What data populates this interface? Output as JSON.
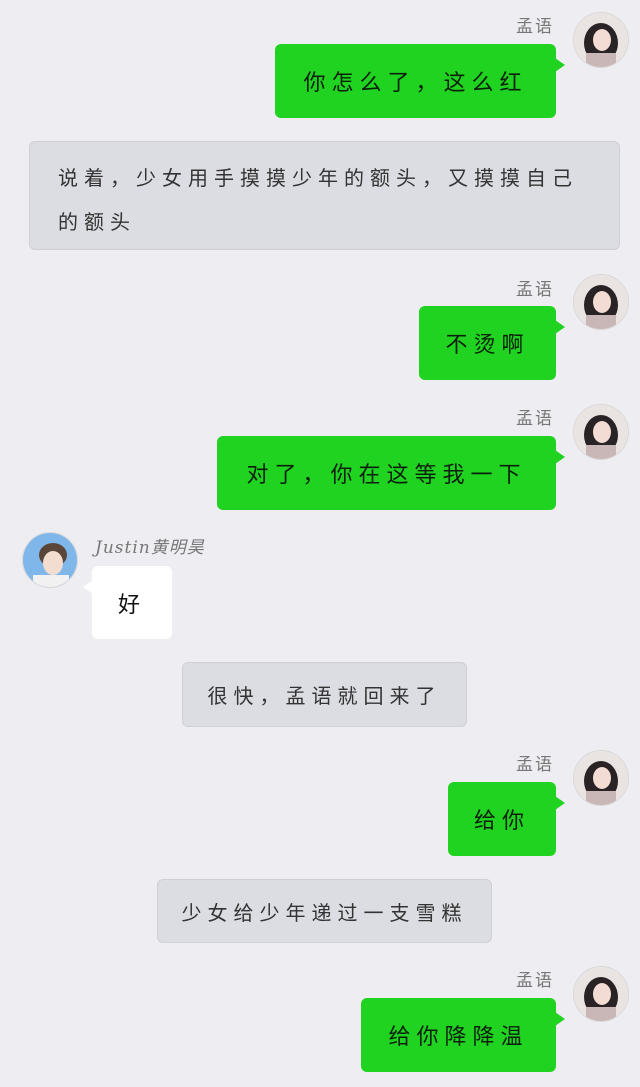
{
  "sender_me": "孟语",
  "sender_other": "Justin黄明昊",
  "colors": {
    "background": "#ededf2",
    "my_bubble": "#21d321",
    "other_bubble": "#ffffff",
    "narration_bubble": "#dcdde3"
  },
  "messages": [
    {
      "type": "me",
      "text": "你怎么了，这么红"
    },
    {
      "type": "narration",
      "text": "说着，少女用手摸摸少年的额头，又摸摸自己的额头"
    },
    {
      "type": "me",
      "text": "不烫啊"
    },
    {
      "type": "me",
      "text": "对了，你在这等我一下"
    },
    {
      "type": "other",
      "text": "好"
    },
    {
      "type": "narration",
      "text": "很快，孟语就回来了"
    },
    {
      "type": "me",
      "text": "给你"
    },
    {
      "type": "narration",
      "text": "少女给少年递过一支雪糕"
    },
    {
      "type": "me",
      "text": "给你降降温"
    }
  ]
}
